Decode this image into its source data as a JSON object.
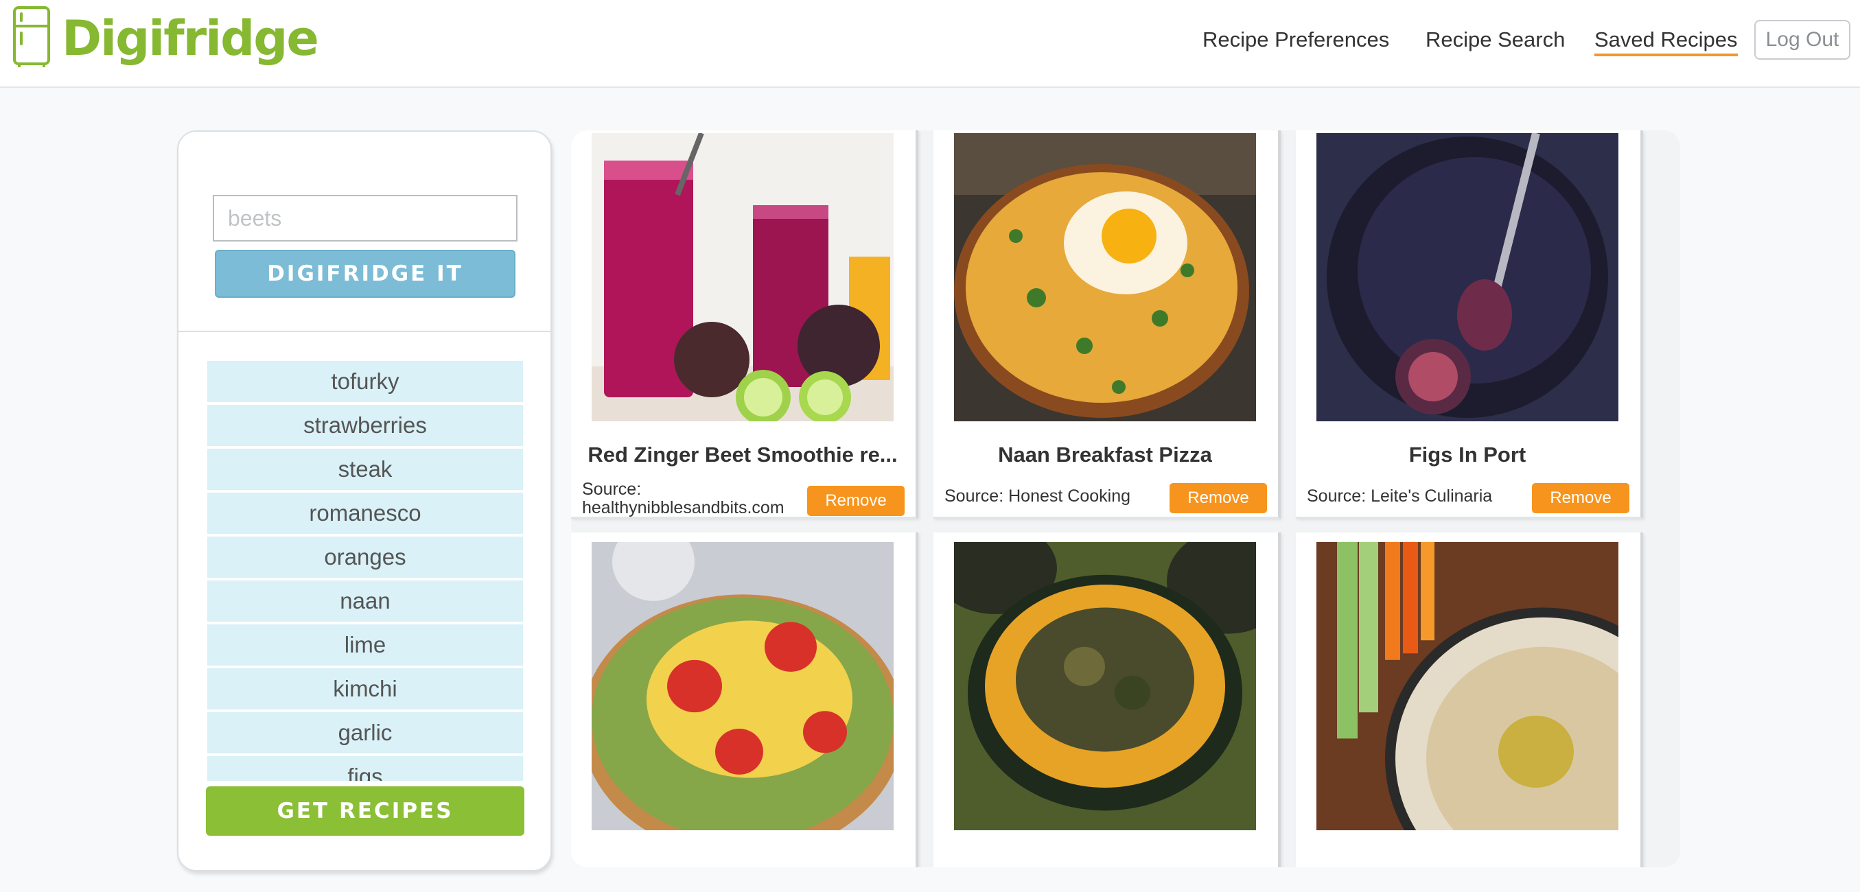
{
  "header": {
    "logo_text": "Digifridge",
    "nav": {
      "preferences": "Recipe Preferences",
      "search": "Recipe Search",
      "saved": "Saved Recipes",
      "logout": "Log Out"
    },
    "accent_color": "#86b832",
    "active_underline_color": "#f5962b"
  },
  "sidebar": {
    "search_placeholder": "beets",
    "search_value": "",
    "digifridge_button": "DIGIFRIDGE IT",
    "ingredients": [
      "tofurky",
      "strawberries",
      "steak",
      "romanesco",
      "oranges",
      "naan",
      "lime",
      "kimchi",
      "garlic",
      "figs"
    ],
    "get_recipes_button": "GET RECIPES"
  },
  "recipes": [
    {
      "title": "Red Zinger Beet Smoothie re...",
      "source_label": "Source:",
      "source": "healthynibblesandbits.com",
      "remove_label": "Remove",
      "image": "beet-smoothie-photo"
    },
    {
      "title": "Naan Breakfast Pizza",
      "source_label": "Source:",
      "source": "Honest Cooking",
      "remove_label": "Remove",
      "image": "naan-pizza-photo"
    },
    {
      "title": "Figs In Port",
      "source_label": "Source:",
      "source": "Leite's Culinaria",
      "remove_label": "Remove",
      "image": "figs-in-port-photo"
    },
    {
      "title": "",
      "source": "",
      "remove_label": "",
      "image": "corn-tomato-flatbread-photo"
    },
    {
      "title": "",
      "source": "",
      "remove_label": "",
      "image": "stuffed-squash-photo"
    },
    {
      "title": "",
      "source": "",
      "remove_label": "",
      "image": "hummus-veggies-photo"
    }
  ],
  "colors": {
    "primary_button": "#7cbcd6",
    "get_recipes": "#8bbf36",
    "remove": "#f7941d",
    "ingredient_bg": "#d9f1f7"
  }
}
